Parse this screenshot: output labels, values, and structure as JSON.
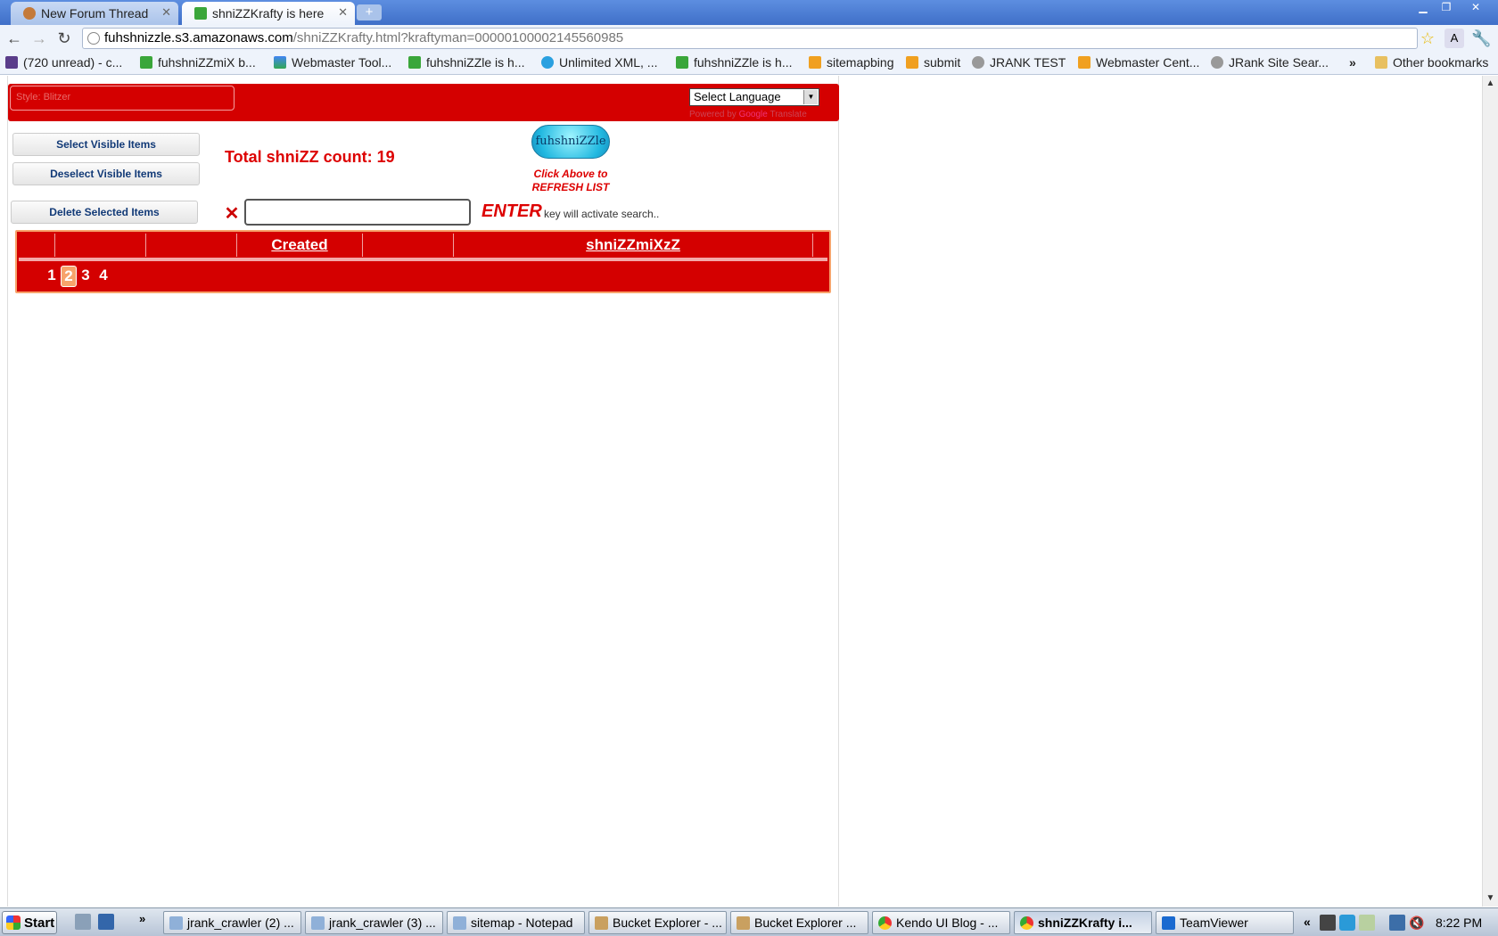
{
  "browser": {
    "tabs": [
      {
        "title": "New Forum Thread",
        "active": false
      },
      {
        "title": "shniZZKrafty is here",
        "active": true
      }
    ],
    "address": {
      "host": "fuhshnizzle.s3.amazonaws.com",
      "path": "/shniZZKrafty.html?kraftyman=000001000021455609​85"
    },
    "bookmarks": [
      {
        "label": "(720 unread) - c...",
        "icon": "mail-icon"
      },
      {
        "label": "fuhshniZZmiX b...",
        "icon": "page-icon"
      },
      {
        "label": "Webmaster Tool...",
        "icon": "google-icon"
      },
      {
        "label": "fuhshniZZle is h...",
        "icon": "page-icon"
      },
      {
        "label": "Unlimited XML, ...",
        "icon": "globe-icon"
      },
      {
        "label": "fuhshniZZle is h...",
        "icon": "page-icon"
      },
      {
        "label": "sitemapbing",
        "icon": "bing-icon"
      },
      {
        "label": "submit",
        "icon": "bing-icon"
      },
      {
        "label": "JRANK TEST",
        "icon": "globe-icon"
      },
      {
        "label": "Webmaster Cent...",
        "icon": "bing-icon"
      },
      {
        "label": "JRank Site Sear...",
        "icon": "globe-icon"
      }
    ],
    "bookmarks_overflow": "»",
    "other_bookmarks": "Other bookmarks"
  },
  "page": {
    "style_input_placeholder": "Style: Blitzer",
    "language_select": "Select Language",
    "powered_by": "Powered by",
    "powered_google": "Google",
    "powered_translate": "Translate",
    "buttons": {
      "select_visible": "Select Visible Items",
      "deselect_visible": "Deselect Visible Items",
      "delete_selected": "Delete Selected Items"
    },
    "total_count_label": "Total shniZZ count: 19",
    "refresh_logo_text": "fuhshniZZle",
    "refresh_note_line1": "Click Above to",
    "refresh_note_line2": "REFRESH LIST",
    "search_value": "",
    "enter_word": "ENTER",
    "enter_hint": "key will activate search..",
    "grid_columns": [
      "",
      "",
      "",
      "Created",
      "",
      "shniZZmiXzZ"
    ],
    "pages": [
      "1",
      "2",
      "3",
      "4"
    ],
    "current_page": "2"
  },
  "taskbar": {
    "start": "Start",
    "tasks": [
      {
        "label": "jrank_crawler (2) ...",
        "active": false
      },
      {
        "label": "jrank_crawler (3) ...",
        "active": false
      },
      {
        "label": "sitemap - Notepad",
        "active": false
      },
      {
        "label": "Bucket Explorer - ...",
        "active": false
      },
      {
        "label": "Bucket Explorer ...",
        "active": false
      },
      {
        "label": "Kendo UI Blog - ...",
        "active": false
      },
      {
        "label": "shniZZKrafty i...",
        "active": true
      },
      {
        "label": "TeamViewer",
        "active": false
      }
    ],
    "clock": "8:22 PM"
  },
  "colors": {
    "page_red": "#d40000",
    "text_red": "#dd0000",
    "accent_orange": "#f7a36b",
    "chrome_blue": "#3f6fc8"
  }
}
